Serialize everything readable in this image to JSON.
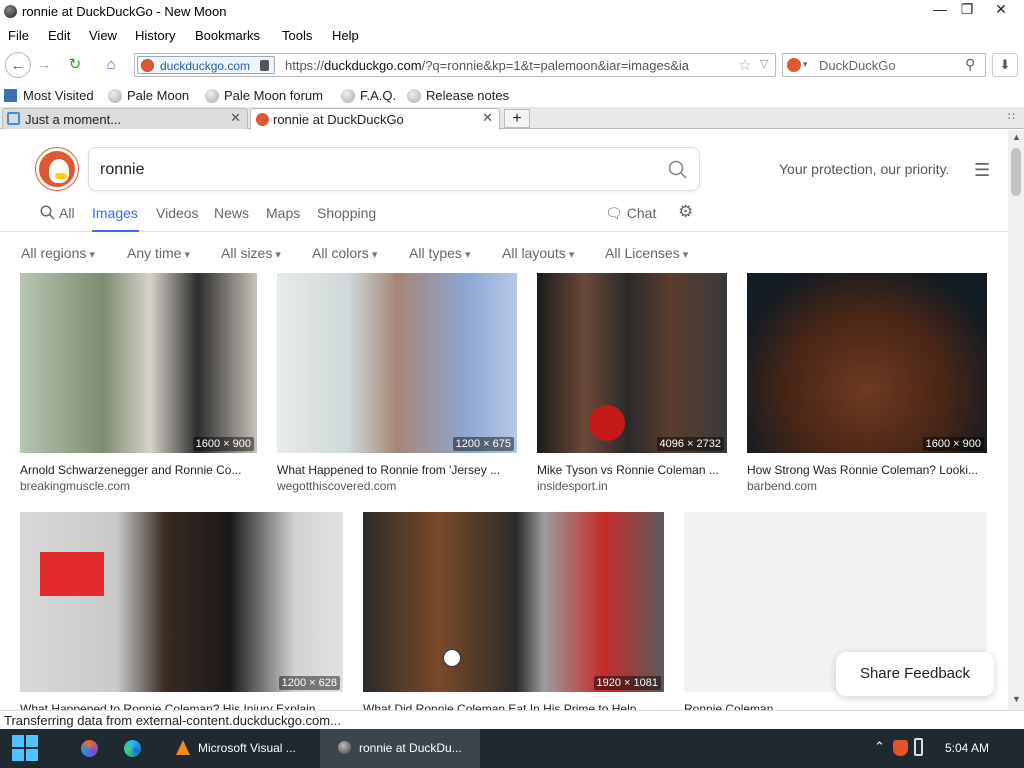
{
  "window": {
    "title": "ronnie at DuckDuckGo - New Moon",
    "minimize": "—",
    "maximize": "❐",
    "close": "✕"
  },
  "menubar": [
    "File",
    "Edit",
    "View",
    "History",
    "Bookmarks",
    "Tools",
    "Help"
  ],
  "navbar": {
    "identity": "duckduckgo.com",
    "url_prefix": "https://",
    "url_host": "duckduckgo.com",
    "url_rest": "/?q=ronnie&kp=1&t=palemoon&iar=images&ia",
    "search_engine": "DuckDuckGo"
  },
  "bookmarks": [
    "Most Visited",
    "Pale Moon",
    "Pale Moon forum",
    "F.A.Q.",
    "Release notes"
  ],
  "tabs": [
    {
      "label": "Just a moment...",
      "active": false
    },
    {
      "label": "ronnie at DuckDuckGo",
      "active": true
    }
  ],
  "new_tab": "+",
  "page": {
    "query": "ronnie",
    "tagline": "Your protection, our priority.",
    "verticals": [
      "All",
      "Images",
      "Videos",
      "News",
      "Maps",
      "Shopping"
    ],
    "active_vertical": "Images",
    "chat": "Chat",
    "filters": [
      "All regions",
      "Any time",
      "All sizes",
      "All colors",
      "All types",
      "All layouts",
      "All Licenses"
    ],
    "results": [
      {
        "caption": "Arnold Schwarzenegger and Ronnie Co...",
        "source": "breakingmuscle.com",
        "dims": "1600 × 900"
      },
      {
        "caption": "What Happened to Ronnie from 'Jersey ...",
        "source": "wegotthiscovered.com",
        "dims": "1200 × 675"
      },
      {
        "caption": "Mike Tyson vs Ronnie Coleman ...",
        "source": "insidesport.in",
        "dims": "4096 × 2732"
      },
      {
        "caption": "How Strong Was Ronnie Coleman? Looki...",
        "source": "barbend.com",
        "dims": "1600 × 900"
      },
      {
        "caption": "What Happened to Ronnie Coleman? His Injury Explain...",
        "source": "",
        "dims": "1200 × 628"
      },
      {
        "caption": "What Did Ronnie Coleman Eat In His Prime to Help...",
        "source": "",
        "dims": "1920 × 1081"
      },
      {
        "caption": "Ronnie Coleman",
        "source": "",
        "dims": ""
      }
    ],
    "feedback": "Share Feedback"
  },
  "status": "Transferring data from external-content.duckduckgo.com...",
  "taskbar": {
    "apps": [
      "Microsoft Visual ...",
      "ronnie at DuckDu..."
    ],
    "clock": "5:04 AM"
  },
  "colors": {
    "accent": "#3969ef",
    "ddg_orange": "#de5833",
    "taskbar": "#1f2a30"
  }
}
